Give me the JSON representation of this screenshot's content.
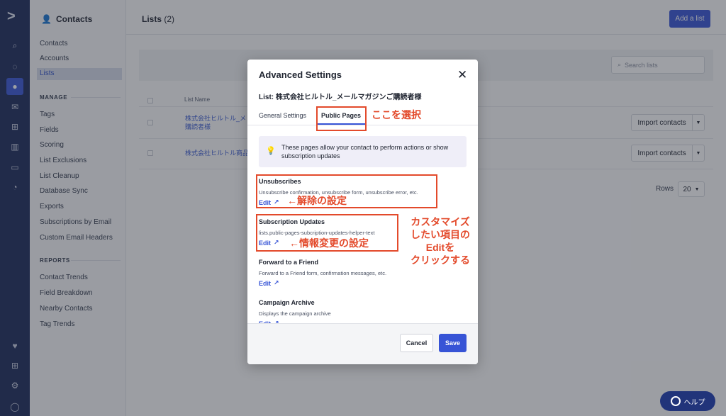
{
  "rail": {
    "icons": [
      "logo-chevron-icon",
      "search-icon",
      "location-pin-icon",
      "contacts-icon",
      "mail-icon",
      "automation-icon",
      "pipeline-icon",
      "website-icon",
      "reports-icon",
      "heart-icon",
      "apps-icon",
      "gear-icon",
      "user-avatar-icon"
    ]
  },
  "sidebar": {
    "title": "Contacts",
    "items": [
      "Contacts",
      "Accounts",
      "Lists"
    ],
    "manage_label": "MANAGE",
    "manage_items": [
      "Tags",
      "Fields",
      "Scoring",
      "List Exclusions",
      "List Cleanup",
      "Database Sync",
      "Exports",
      "Subscriptions by Email",
      "Custom Email Headers"
    ],
    "reports_label": "REPORTS",
    "reports_items": [
      "Contact Trends",
      "Field Breakdown",
      "Nearby Contacts",
      "Tag Trends"
    ]
  },
  "main": {
    "title": "Lists",
    "count": "(2)",
    "add_button": "Add a list",
    "search_placeholder": "Search lists",
    "column_list_name": "List Name",
    "rows": [
      {
        "name_line1": "株式会社ヒルトル_メ",
        "name_line2": "購読者様",
        "action": "Import contacts"
      },
      {
        "name_line1": "株式会社ヒルトル商品",
        "name_line2": "",
        "action": "Import contacts"
      }
    ],
    "rows_label": "Rows",
    "rows_value": "20"
  },
  "modal": {
    "title": "Advanced Settings",
    "close": "✕",
    "list_label": "List: 株式会社ヒルトル_メールマガジンご購読者様",
    "tab_general": "General Settings",
    "tab_public": "Public Pages",
    "info_text": "These pages allow your contact to perform actions or show subscription updates",
    "sections": [
      {
        "title": "Unsubscribes",
        "desc": "Unsubscribe confirmation, unsubscribe form, unsubscribe error, etc.",
        "edit": "Edit"
      },
      {
        "title": "Subscription Updates",
        "desc": "lists.public-pages-subcription-updates-helper-text",
        "edit": "Edit"
      },
      {
        "title": "Forward to a Friend",
        "desc": "Forward to a Friend form, confirmation messages, etc.",
        "edit": "Edit"
      },
      {
        "title": "Campaign Archive",
        "desc": "Displays the campaign archive",
        "edit": "Edit"
      }
    ],
    "cancel": "Cancel",
    "save": "Save"
  },
  "annotations": {
    "select_here": "ここを選択",
    "unsub_setting": "←解除の設定",
    "info_change_setting": "←情報変更の設定",
    "customize_note": [
      "カスタマイズ",
      "したい項目の",
      "Editを",
      "クリックする"
    ]
  },
  "help": {
    "label": "ヘルプ"
  },
  "colors": {
    "accent": "#3754d6",
    "rail": "#1c2b59",
    "annotation": "#e34a2b"
  }
}
